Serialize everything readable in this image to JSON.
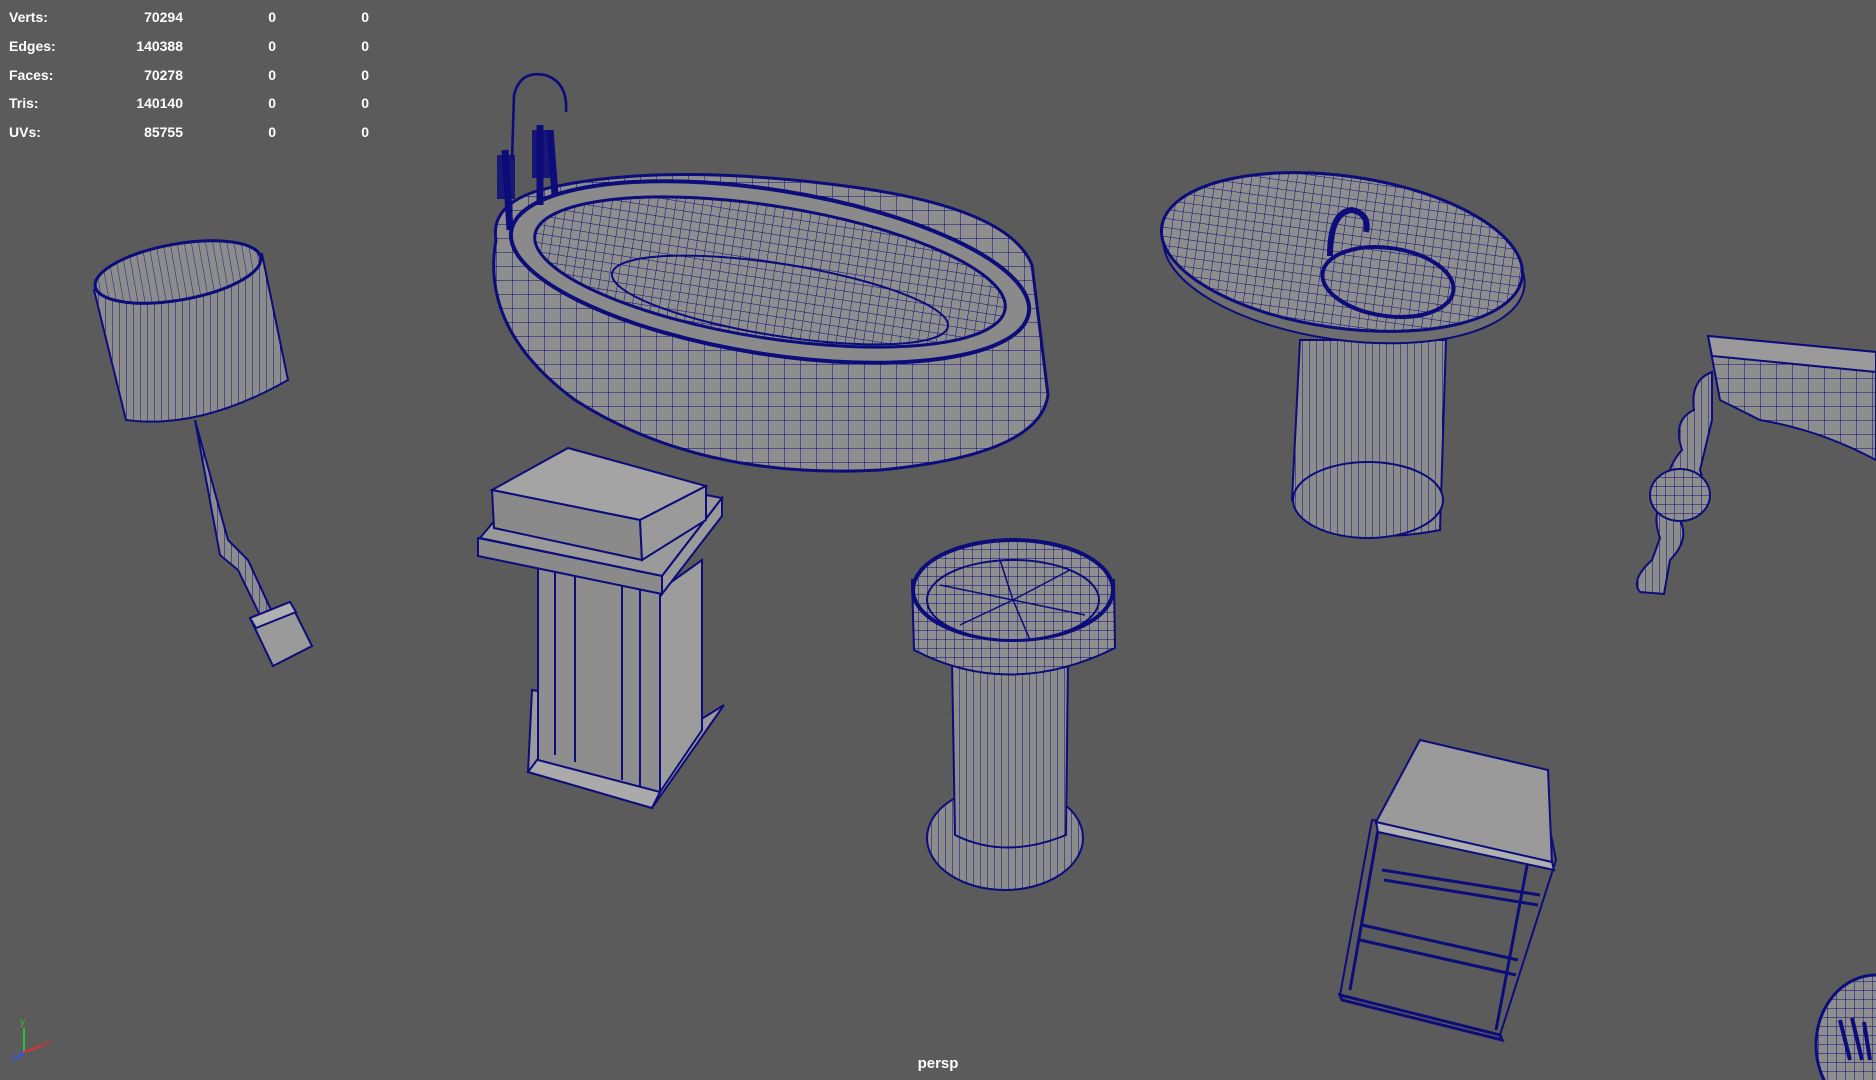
{
  "hud": {
    "rows": [
      {
        "label": "Verts:",
        "v0": "70294",
        "v1": "0",
        "v2": "0"
      },
      {
        "label": "Edges:",
        "v0": "140388",
        "v1": "0",
        "v2": "0"
      },
      {
        "label": "Faces:",
        "v0": "70278",
        "v1": "0",
        "v2": "0"
      },
      {
        "label": "Tris:",
        "v0": "140140",
        "v1": "0",
        "v2": "0"
      },
      {
        "label": "UVs:",
        "v0": "85755",
        "v1": "0",
        "v2": "0"
      }
    ]
  },
  "camera": {
    "name": "persp"
  },
  "axis": {
    "y_label": "y",
    "x_label": "x",
    "z_label": "z"
  },
  "colors": {
    "background": "#5b5b5b",
    "wireframe": "#0c0c7a",
    "hud_text": "#ffffff",
    "axis_x": "#e03030",
    "axis_y": "#30c030",
    "axis_z": "#3050ff"
  },
  "objects": [
    "table-lamp",
    "bathtub",
    "pedestal-sink",
    "console-table",
    "lectern-stand",
    "round-pedestal",
    "side-table",
    "partial-object"
  ]
}
